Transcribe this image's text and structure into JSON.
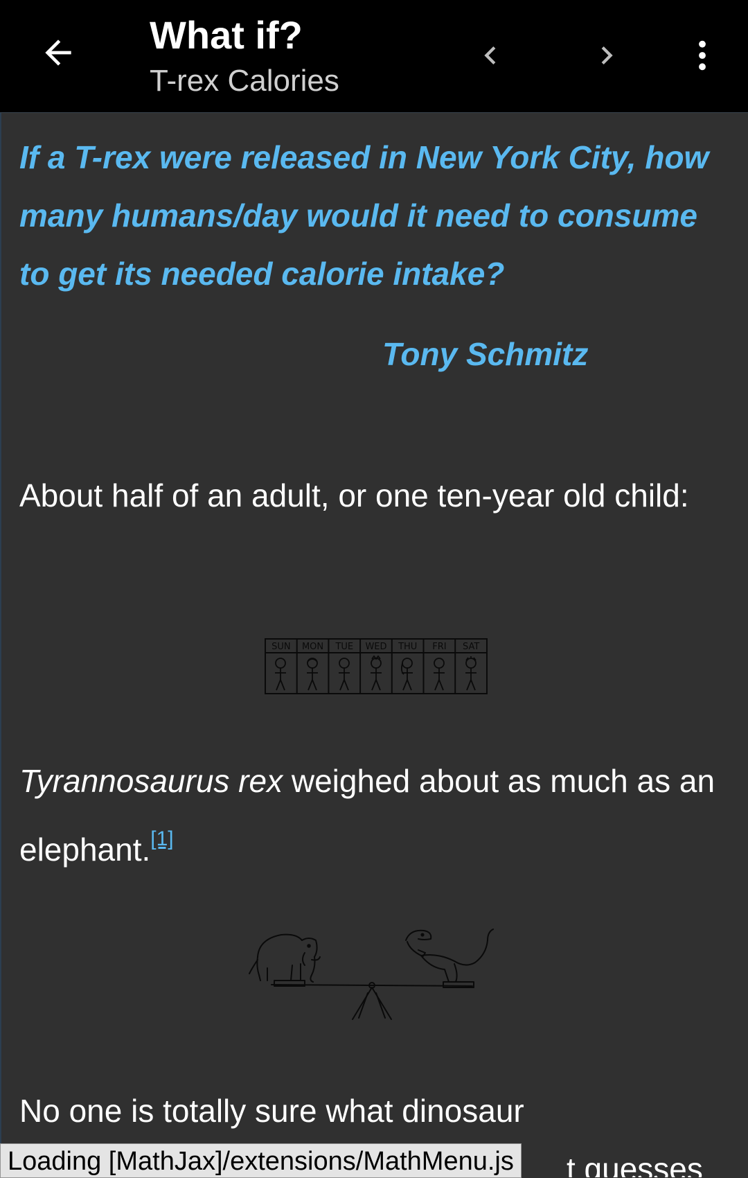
{
  "appbar": {
    "title": "What if?",
    "subtitle": "T-rex Calories",
    "icons": [
      "arrow-left-icon",
      "chevron-left-icon",
      "chevron-right-icon",
      "more-vert-icon"
    ]
  },
  "article": {
    "question": "If a T-rex were released in New York City, how many humans/day would it need to consume to get its needed calorie intake?",
    "attribution": "Tony Schmitz",
    "paragraph1": "About half of an adult, or one ten-year old child:",
    "paragraph2_italic": "Tyrannosaurus rex",
    "paragraph2_rest": " weighed about as much as an elephant.",
    "footnote_ref": "[1]",
    "paragraph3": "No one is totally sure what dinosaur",
    "paragraph3_tail": "t guesses",
    "calendar_days": [
      "SUN",
      "MON",
      "TUE",
      "WED",
      "THU",
      "FRI",
      "SAT"
    ]
  },
  "status": {
    "mathjax": "Loading [MathJax]/extensions/MathMenu.js"
  },
  "colors": {
    "appbar_bg": "#000000",
    "page_bg": "#303030",
    "accent": "#5ab9f0",
    "text": "#ffffff"
  }
}
